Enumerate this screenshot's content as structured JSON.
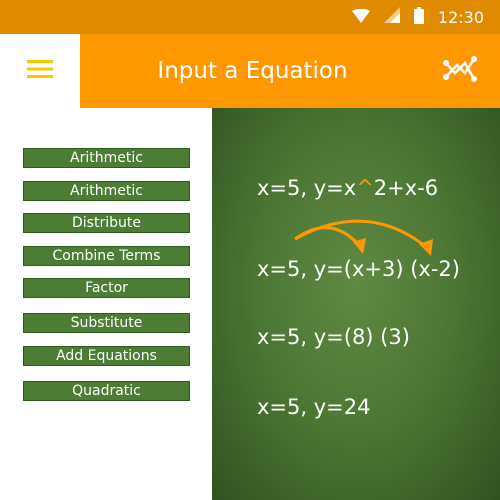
{
  "status_bar": {
    "time": "12:30",
    "icons": [
      "wifi-icon",
      "signal-icon",
      "battery-icon"
    ]
  },
  "app_bar": {
    "title": "Input a Equation",
    "menu_icon": "hamburger-menu-icon",
    "action_icon": "graph-icon"
  },
  "steps": [
    {
      "label": "Arithmetic"
    },
    {
      "label": "Arithmetic"
    },
    {
      "label": "Distribute"
    },
    {
      "label": "Combine Terms"
    },
    {
      "label": "Factor"
    },
    {
      "label": "Substitute"
    },
    {
      "label": "Add Equations"
    },
    {
      "label": "Quadratic"
    }
  ],
  "board": {
    "line1": {
      "prefix": "x=5, y=x",
      "caret": "^",
      "suffix": "2+x-6"
    },
    "line2": "x=5, y=(x+3) (x-2)",
    "line3": "x=5, y=(8) (3)",
    "line4": "x=5, y=24"
  },
  "colors": {
    "accent": "#ff9800",
    "status_bar": "#e08a00",
    "button_green": "#4d7c35",
    "board_green": "#4b7533"
  }
}
